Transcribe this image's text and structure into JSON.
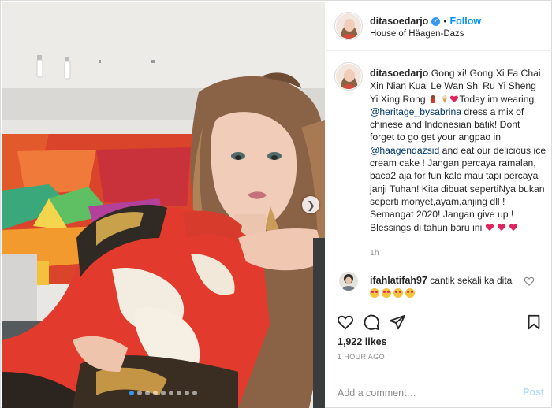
{
  "post": {
    "username": "ditasoedarjo",
    "follow_label": "Follow",
    "separator": "•",
    "location": "House of Häagen-Dazs",
    "verified_icon": "verified-badge-icon"
  },
  "caption": {
    "username": "ditasoedarjo",
    "part1": " Gong xi! Gong Xi Fa Chai Xin Nian Kuai Le Wan Shi Ru Yi Sheng Yi Xing Rong ",
    "part2": "Today im wearing ",
    "mention1": "@heritage_bysabrina",
    "part3": " dress a mix of chinese and Indonesian batik! Dont forget to go get your angpao in ",
    "mention2": "@haagendazsid",
    "part4": " and eat our delicious ice cream cake ! Jangan percaya ramalan, baca2 aja for fun kalo mau tapi percaya janji Tuhan! Kita dibuat sepertiNya bukan seperti monyet,ayam,anjing dll ! Semangat 2020! Jangan give up ! Blessings di tahun baru ini",
    "time": "1h"
  },
  "comment": {
    "username": "ifahlatifah97",
    "text": " cantik sekali ka dita"
  },
  "actions": {
    "likes": "1,922 likes",
    "ago": "1 HOUR AGO"
  },
  "composer": {
    "placeholder": "Add a comment…",
    "post_label": "Post"
  },
  "carousel": {
    "total": 9,
    "active_index": 0
  },
  "colors": {
    "accent": "#0095f6",
    "mention": "#00376b",
    "muted": "#8e8e8e",
    "heart": "#e0245e"
  }
}
